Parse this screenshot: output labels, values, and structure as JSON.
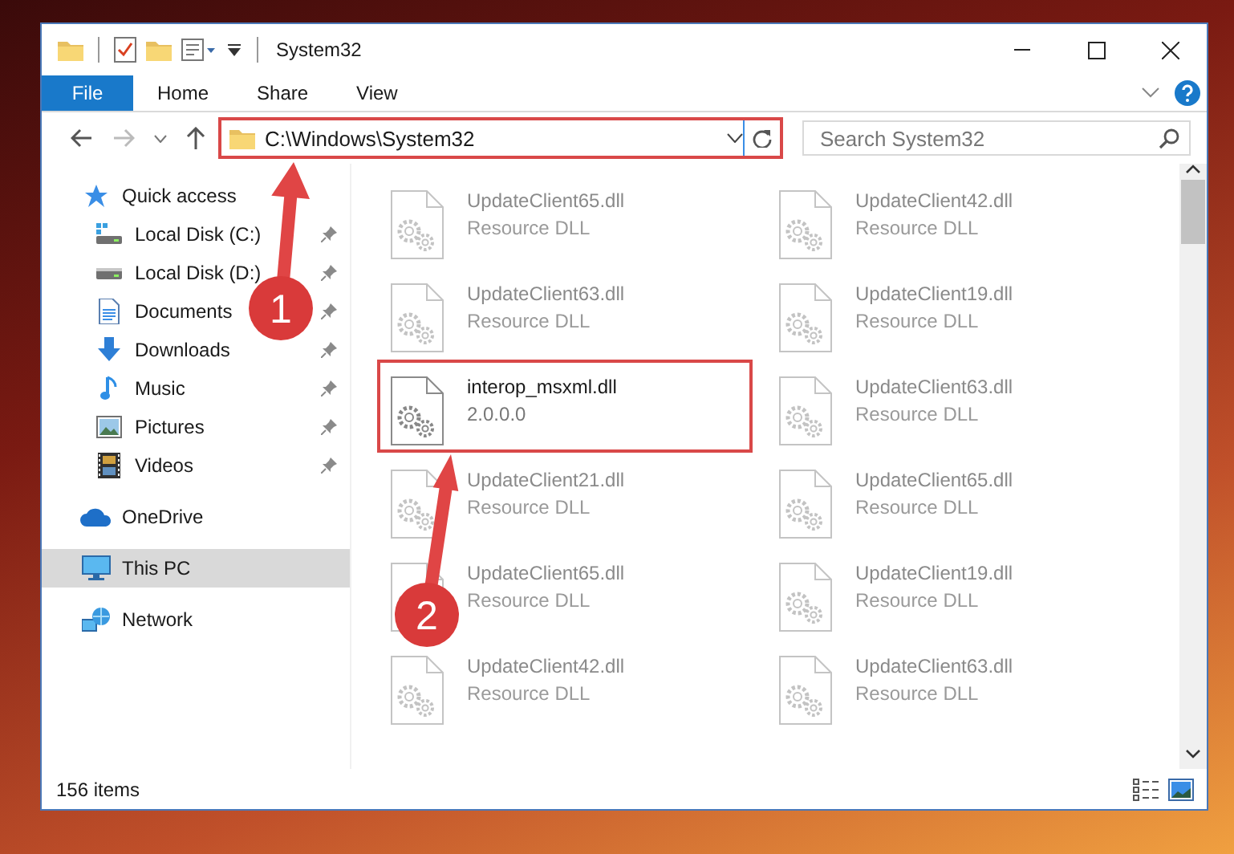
{
  "window": {
    "title": "System32"
  },
  "ribbon": {
    "tabs": [
      {
        "label": "File",
        "kind": "file",
        "selected": false
      },
      {
        "label": "Home",
        "kind": "tab",
        "selected": false
      },
      {
        "label": "Share",
        "kind": "tab",
        "selected": false
      },
      {
        "label": "View",
        "kind": "tab",
        "selected": false
      }
    ]
  },
  "address_bar": {
    "path": "C:\\Windows\\System32",
    "highlighted": true
  },
  "search": {
    "placeholder": "Search System32"
  },
  "navigation": {
    "items": [
      {
        "label": "Quick access",
        "kind": "star",
        "selected": false,
        "children": [
          {
            "label": "Local Disk (C:)",
            "kind": "drive-c",
            "pinned": true,
            "selected": false
          },
          {
            "label": "Local Disk (D:)",
            "kind": "drive",
            "pinned": true,
            "selected": false
          },
          {
            "label": "Documents",
            "kind": "documents",
            "pinned": true,
            "selected": false
          },
          {
            "label": "Downloads",
            "kind": "downloads",
            "pinned": true,
            "selected": false
          },
          {
            "label": "Music",
            "kind": "music",
            "pinned": true,
            "selected": false
          },
          {
            "label": "Pictures",
            "kind": "pictures",
            "pinned": true,
            "selected": false
          },
          {
            "label": "Videos",
            "kind": "videos",
            "pinned": true,
            "selected": false
          }
        ]
      },
      {
        "label": "OneDrive",
        "kind": "cloud",
        "selected": false
      },
      {
        "label": "This PC",
        "kind": "computer",
        "selected": true
      },
      {
        "label": "Network",
        "kind": "network",
        "selected": false
      }
    ]
  },
  "files": [
    {
      "name": "UpdateClient65.dll",
      "detail": "Resource DLL",
      "dimmed": true,
      "highlighted": false
    },
    {
      "name": "UpdateClient42.dll",
      "detail": "Resource DLL",
      "dimmed": true,
      "highlighted": false
    },
    {
      "name": "UpdateClient63.dll",
      "detail": "Resource DLL",
      "dimmed": true,
      "highlighted": false
    },
    {
      "name": "UpdateClient19.dll",
      "detail": "Resource DLL",
      "dimmed": true,
      "highlighted": false
    },
    {
      "name": "interop_msxml.dll",
      "detail": "2.0.0.0",
      "dimmed": false,
      "highlighted": true
    },
    {
      "name": "UpdateClient63.dll",
      "detail": "Resource DLL",
      "dimmed": true,
      "highlighted": false
    },
    {
      "name": "UpdateClient21.dll",
      "detail": "Resource DLL",
      "dimmed": true,
      "highlighted": false
    },
    {
      "name": "UpdateClient65.dll",
      "detail": "Resource DLL",
      "dimmed": true,
      "highlighted": false
    },
    {
      "name": "UpdateClient65.dll",
      "detail": "Resource DLL",
      "dimmed": true,
      "highlighted": false
    },
    {
      "name": "UpdateClient19.dll",
      "detail": "Resource DLL",
      "dimmed": true,
      "highlighted": false
    },
    {
      "name": "UpdateClient42.dll",
      "detail": "Resource DLL",
      "dimmed": true,
      "highlighted": false
    },
    {
      "name": "UpdateClient63.dll",
      "detail": "Resource DLL",
      "dimmed": true,
      "highlighted": false
    }
  ],
  "status_bar": {
    "item_count": "156 items"
  },
  "annotations": [
    {
      "number": "1"
    },
    {
      "number": "2"
    }
  ]
}
